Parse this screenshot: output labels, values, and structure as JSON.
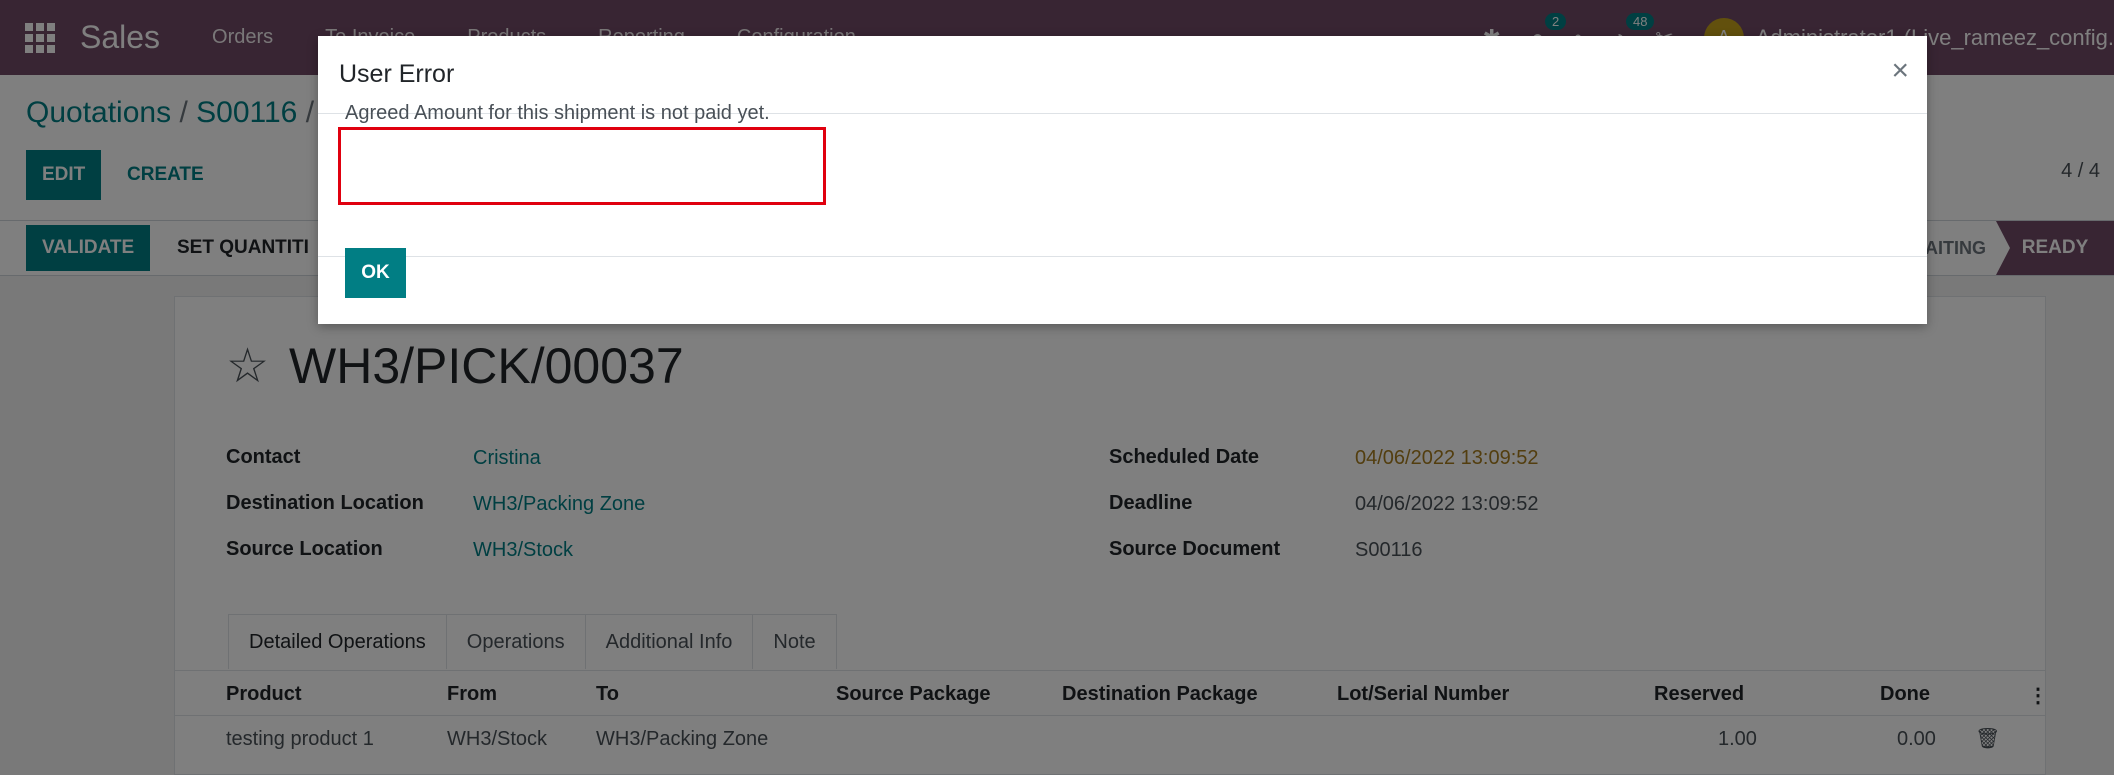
{
  "navbar": {
    "app_name": "Sales",
    "menu": [
      "Orders",
      "To Invoice",
      "Products",
      "Reporting",
      "Configuration"
    ],
    "messages_count": "2",
    "activities_count": "48",
    "avatar_initial": "A",
    "user": "Administrator1 (Live_rameez_config."
  },
  "control_panel": {
    "breadcrumb_root": "Quotations",
    "breadcrumb_sep": "/",
    "breadcrumb_item": "S00116",
    "breadcrumb_sep2": "/",
    "edit_label": "EDIT",
    "create_label": "CREATE",
    "pager": "4 / 4"
  },
  "statusbar": {
    "validate_label": "VALIDATE",
    "set_quantities_label": "SET QUANTITI",
    "stage_waiting": "AITING",
    "stage_ready": "READY"
  },
  "record": {
    "title": "WH3/PICK/00037",
    "left_fields": [
      {
        "label": "Contact",
        "value": "Cristina"
      },
      {
        "label": "Destination Location",
        "value": "WH3/Packing Zone"
      },
      {
        "label": "Source Location",
        "value": "WH3/Stock"
      }
    ],
    "right_fields": [
      {
        "label": "Scheduled Date",
        "value": "04/06/2022 13:09:52"
      },
      {
        "label": "Deadline",
        "value": "04/06/2022 13:09:52"
      },
      {
        "label": "Source Document",
        "value": "S00116"
      }
    ]
  },
  "tabs": [
    "Detailed Operations",
    "Operations",
    "Additional Info",
    "Note"
  ],
  "table": {
    "columns": [
      "Product",
      "From",
      "To",
      "Source Package",
      "Destination Package",
      "Lot/Serial Number",
      "Reserved",
      "Done"
    ],
    "rows": [
      {
        "product": "testing product 1",
        "from": "WH3/Stock",
        "to": "WH3/Packing Zone",
        "reserved": "1.00",
        "done": "0.00"
      }
    ]
  },
  "modal": {
    "title": "User Error",
    "message": "Agreed Amount for this shipment is not paid yet.",
    "ok_label": "OK",
    "close_glyph": "×"
  },
  "colors": {
    "navbar": "#714b67",
    "primary": "#017e84",
    "error_highlight": "#e0000f"
  }
}
